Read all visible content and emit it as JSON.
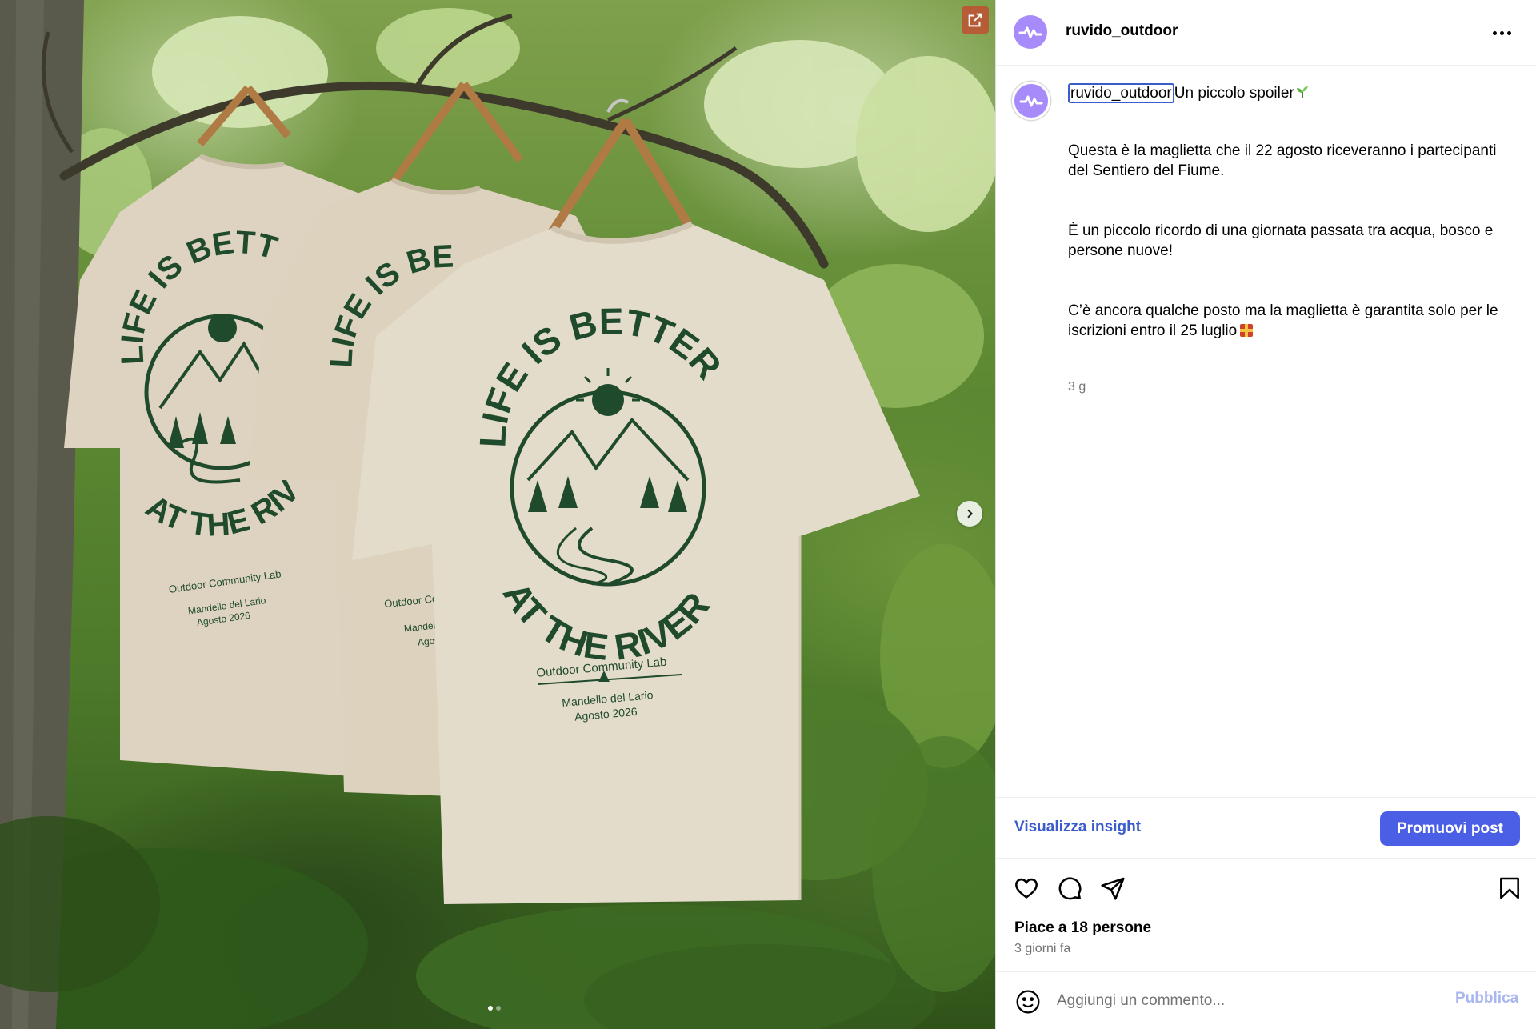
{
  "post": {
    "username": "ruvido_outdoor",
    "caption_user": "ruvido_outdoor",
    "caption_title": "Un piccolo spoiler",
    "caption_paragraphs": [
      "Questa è la maglietta che il 22 agosto riceveranno i partecipanti del Sentiero del Fiume.",
      "È un piccolo ricordo di una giornata passata tra acqua, bosco e persone nuove!",
      "C’è ancora qualche posto ma la maglietta è garantita solo per le iscrizioni entro il 25 luglio"
    ],
    "caption_time": "3 g",
    "likes_text": "Piace a 18 persone",
    "time_ago": "3 giorni fa"
  },
  "actions": {
    "insights_label": "Visualizza insight",
    "promote_label": "Promuovi post",
    "comment_placeholder": "Aggiungi un commento...",
    "publish_label": "Pubblica"
  },
  "shirt_print": {
    "arc_top": "LIFE IS BETTER",
    "arc_bottom": "AT THE RIVER",
    "brand": "Outdoor Community Lab",
    "place": "Mandello del Lario",
    "date": "Agosto 2026",
    "arc_top_partial_1": "LIFE IS BETT",
    "arc_bottom_partial_1": "AT THE RIVE",
    "arc_top_partial_2": "LIFE IS BE",
    "brand_partial_2": "Outdoor Co",
    "place_partial_2": "Mandello",
    "date_partial_2": "Agost"
  },
  "carousel": {
    "current": 1,
    "total": 2
  },
  "colors": {
    "accent": "#4a5ee6",
    "link": "#3b5ccc",
    "avatar": "#a78bfa",
    "print_green": "#1f4a2c",
    "shirt": "#e4dccb"
  },
  "icons": {
    "external": "external-link-icon",
    "next": "chevron-right-icon",
    "more": "more-horizontal-icon",
    "like": "heart-icon",
    "comment": "comment-icon",
    "share": "share-icon",
    "save": "bookmark-icon",
    "emoji": "emoji-icon",
    "sprout": "sprout-emoji",
    "gift": "gift-emoji"
  }
}
